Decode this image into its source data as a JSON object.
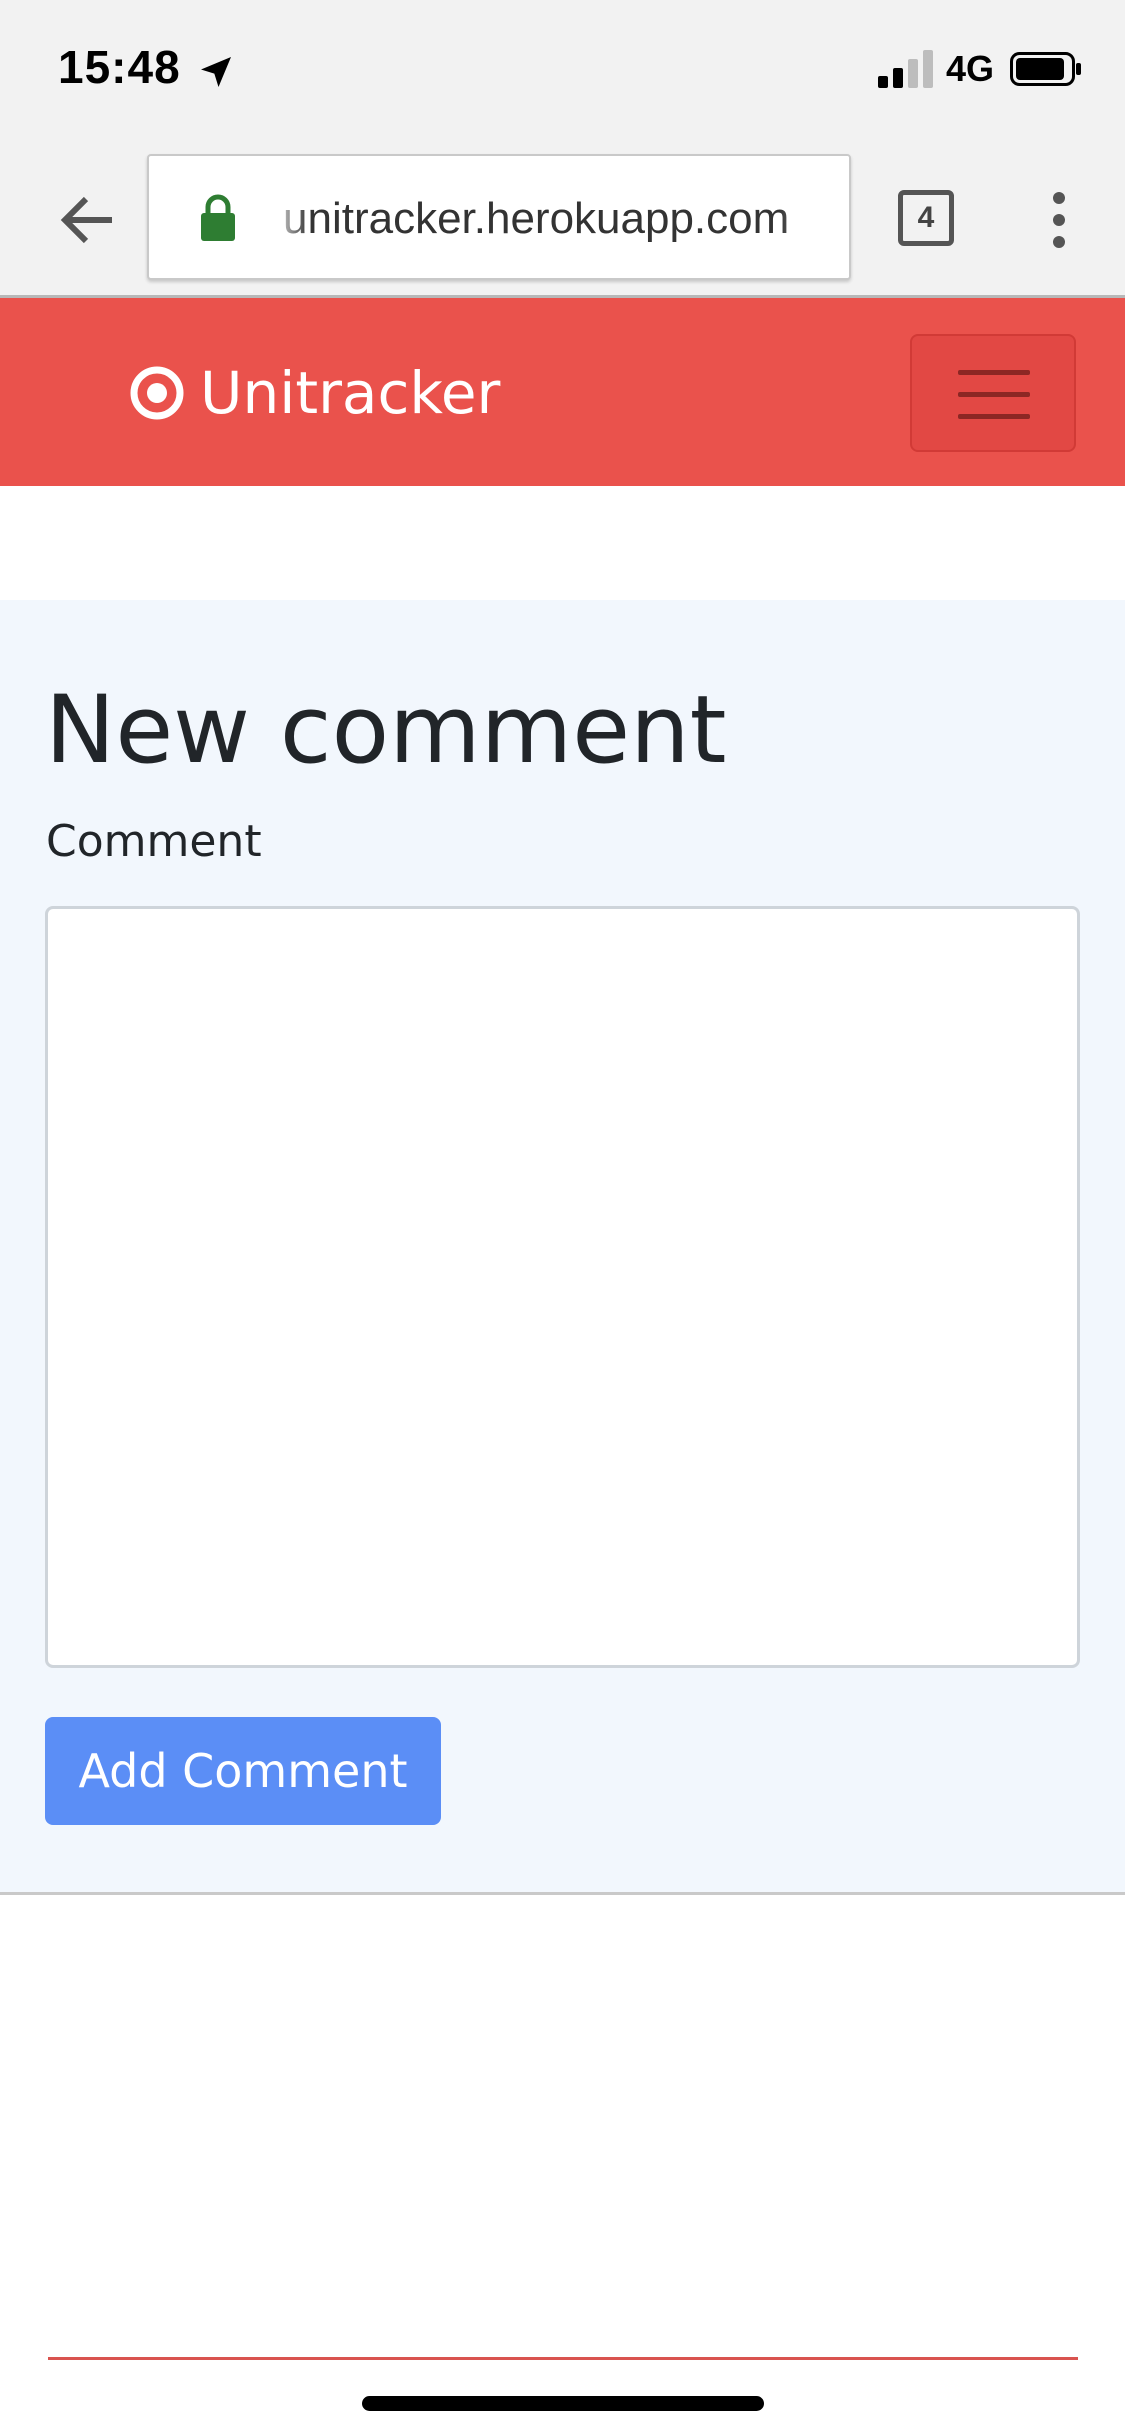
{
  "status_bar": {
    "time": "15:48",
    "network": "4G",
    "icons": [
      "location-arrow-icon",
      "signal-icon",
      "battery-icon"
    ]
  },
  "browser": {
    "url": "unitracker.herokuapp.com",
    "tab_count": "4",
    "icons": [
      "back-arrow-icon",
      "lock-icon",
      "tabs-icon",
      "more-vert-icon"
    ]
  },
  "navbar": {
    "brand": "Unitracker",
    "brand_icon": "target-icon",
    "toggler_icon": "hamburger-icon"
  },
  "form": {
    "title": "New comment",
    "comment_label": "Comment",
    "comment_value": "",
    "submit_label": "Add Comment"
  },
  "colors": {
    "navbar": "#ea524c",
    "button": "#5b8ef6",
    "content_bg": "#f2f7fd",
    "lock": "#2e7d32"
  }
}
